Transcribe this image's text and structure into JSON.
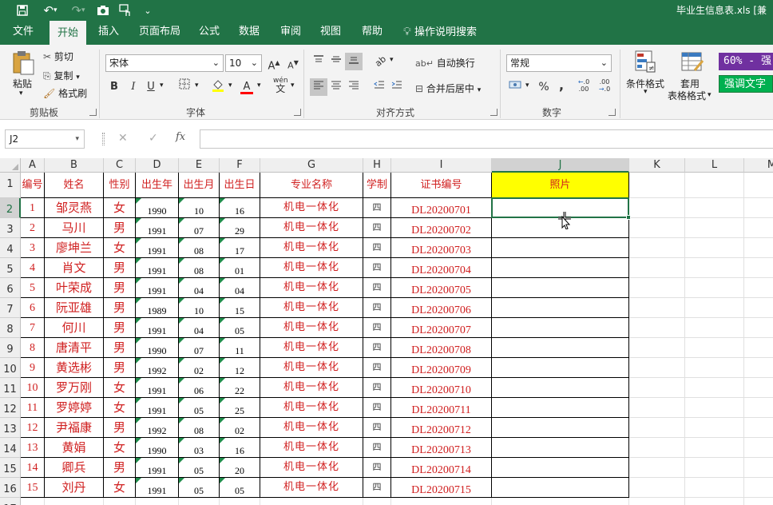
{
  "qat": {
    "save_icon": "save-icon",
    "undo_icon": "undo-icon",
    "redo_icon": "redo-icon",
    "camera_icon": "camera-icon",
    "touch_icon": "touch-mode-icon",
    "more_icon": "customize-qat-icon"
  },
  "window": {
    "title": "毕业生信息表.xls  [兼"
  },
  "tabs": [
    "文件",
    "开始",
    "插入",
    "页面布局",
    "公式",
    "数据",
    "审阅",
    "视图",
    "帮助"
  ],
  "active_tab": "开始",
  "tell_me": "操作说明搜索",
  "ribbon": {
    "clipboard": {
      "paste": "粘贴",
      "cut": "剪切",
      "copy": "复制",
      "format_painter": "格式刷",
      "group": "剪贴板"
    },
    "font": {
      "name": "宋体",
      "size": "10",
      "bold": "B",
      "italic": "I",
      "underline": "U",
      "grow": "A",
      "shrink": "A",
      "wen": "wén\n文",
      "font_color_label": "A",
      "group": "字体"
    },
    "alignment": {
      "wrap": "自动换行",
      "merge": "合并后居中",
      "group": "对齐方式"
    },
    "number": {
      "format": "常规",
      "percent": "%",
      "comma": ",",
      "inc_decimal": "←.0 .00",
      "dec_decimal": ".00 →.0",
      "group": "数字"
    },
    "styles": {
      "conditional": "条件格式",
      "table_format_1": "套用",
      "table_format_2": "表格格式",
      "style1": "60% - 强",
      "style2": "强调文字"
    }
  },
  "formula_bar": {
    "name_box": "J2",
    "cancel": "✕",
    "enter": "✓",
    "fx": "fx",
    "value": ""
  },
  "columns": [
    "A",
    "B",
    "C",
    "D",
    "E",
    "F",
    "G",
    "H",
    "I",
    "J",
    "K",
    "L",
    "M"
  ],
  "selected_column": "J",
  "selected_row": 2,
  "rows": [
    "1",
    "2",
    "3",
    "4",
    "5",
    "6",
    "7",
    "8",
    "9",
    "10",
    "11",
    "12",
    "13",
    "14",
    "15",
    "16",
    "17"
  ],
  "table": {
    "headers": [
      "编号",
      "姓名",
      "性别",
      "出生年",
      "出生月",
      "出生日",
      "专业名称",
      "学制",
      "证书编号",
      "照片"
    ],
    "records": [
      [
        "1",
        "邹灵燕",
        "女",
        "1990",
        "10",
        "16",
        "机电一体化",
        "四",
        "DL20200701"
      ],
      [
        "2",
        "马川",
        "男",
        "1991",
        "07",
        "29",
        "机电一体化",
        "四",
        "DL20200702"
      ],
      [
        "3",
        "廖坤兰",
        "女",
        "1991",
        "08",
        "17",
        "机电一体化",
        "四",
        "DL20200703"
      ],
      [
        "4",
        "肖文",
        "男",
        "1991",
        "08",
        "01",
        "机电一体化",
        "四",
        "DL20200704"
      ],
      [
        "5",
        "叶荣成",
        "男",
        "1991",
        "04",
        "04",
        "机电一体化",
        "四",
        "DL20200705"
      ],
      [
        "6",
        "阮亚雄",
        "男",
        "1989",
        "10",
        "15",
        "机电一体化",
        "四",
        "DL20200706"
      ],
      [
        "7",
        "何川",
        "男",
        "1991",
        "04",
        "05",
        "机电一体化",
        "四",
        "DL20200707"
      ],
      [
        "8",
        "唐清平",
        "男",
        "1990",
        "07",
        "11",
        "机电一体化",
        "四",
        "DL20200708"
      ],
      [
        "9",
        "黄选彬",
        "男",
        "1992",
        "02",
        "12",
        "机电一体化",
        "四",
        "DL20200709"
      ],
      [
        "10",
        "罗万刚",
        "女",
        "1991",
        "06",
        "22",
        "机电一体化",
        "四",
        "DL20200710"
      ],
      [
        "11",
        "罗婷婷",
        "女",
        "1991",
        "05",
        "25",
        "机电一体化",
        "四",
        "DL20200711"
      ],
      [
        "12",
        "尹福康",
        "男",
        "1992",
        "08",
        "02",
        "机电一体化",
        "四",
        "DL20200712"
      ],
      [
        "13",
        "黄娟",
        "女",
        "1990",
        "03",
        "16",
        "机电一体化",
        "四",
        "DL20200713"
      ],
      [
        "14",
        "卿兵",
        "男",
        "1991",
        "05",
        "20",
        "机电一体化",
        "四",
        "DL20200714"
      ],
      [
        "15",
        "刘丹",
        "女",
        "1991",
        "05",
        "05",
        "机电一体化",
        "四",
        "DL20200715"
      ]
    ]
  },
  "colors": {
    "excel_green": "#217346",
    "data_red": "#d02020",
    "header_yellow": "#ffff00",
    "style_purple": "#7030a0",
    "style_green": "#00b050"
  }
}
